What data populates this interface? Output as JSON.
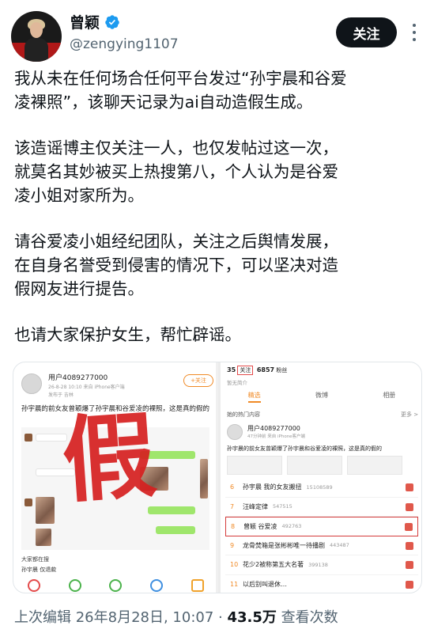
{
  "author": {
    "display_name": "曾颖",
    "handle": "@zengying1107",
    "verified": true
  },
  "actions": {
    "follow_label": "关注",
    "more_icon": "more-vertical-icon"
  },
  "tweet": {
    "paragraphs": [
      "我从未在任何场合任何平台发过“孙宇晨和谷爱\n凌裸照”，该聊天记录为ai自动造假生成。",
      "该造谣博主仅关注一人，也仅发帖过这一次，\n就莫名其妙被买上热搜第八，个人认为是谷爱\n凌小姐对家所为。",
      "请谷爱凌小姐经纪团队，关注之后舆情发展，\n在自身名誉受到侵害的情况下，可以坚决对造\n假网友进行提告。",
      "也请大家保护女生，帮忙辟谣。"
    ]
  },
  "media": {
    "left": {
      "user": "用户4089277000",
      "meta": "26-8-28 10:10 来自 iPhone客户端",
      "meta2": "发布于 吉林",
      "follow_label": "+关注",
      "text": "孙宇晨的前女友曾颖爆了孙宇晨和谷爱凌的裸照，这是真的假的",
      "stamp": "假",
      "caption": "大家都在搜",
      "subcaption": "孙宇晨 仅退款"
    },
    "right": {
      "stat_following": "35",
      "stat_following_label": "关注",
      "stat_fans": "6857",
      "stat_fans_label": "粉丝",
      "bio": "暂无简介",
      "tabs": [
        "精选",
        "微博",
        "相册"
      ],
      "section": "她的热门内容",
      "more": "更多 >",
      "post_user": "用户4089277000",
      "post_meta": "47分钟前 来自 iPhone客户端",
      "post_text": "孙宇晨的前女友曾颖爆了孙宇晨和谷爱凌的裸照，这是真的假的",
      "trending": [
        {
          "rank": "6",
          "title": "孙宇晨 我的女友搬扭",
          "count": "15108589"
        },
        {
          "rank": "7",
          "title": "汪峰定律",
          "count": "547515"
        },
        {
          "rank": "8",
          "title": "曾颖 谷爱凌",
          "count": "492763"
        },
        {
          "rank": "9",
          "title": "龙骨焚箱是张彬彬唯一待播剧",
          "count": "443487"
        },
        {
          "rank": "10",
          "title": "花少2被称第五大名著",
          "count": "399138"
        },
        {
          "rank": "11",
          "title": "以后别叫退休…",
          "count": ""
        }
      ]
    }
  },
  "footer": {
    "edited": "上次编辑 26年8月28日, 10:07 · ",
    "views_count": "43.5万",
    "views_label": " 查看次数"
  }
}
